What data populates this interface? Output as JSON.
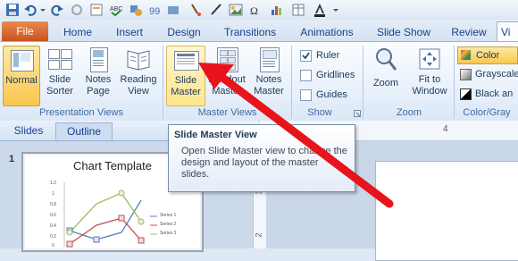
{
  "qat": {
    "icons": [
      "save-icon",
      "undo-icon",
      "redo-icon",
      "repeat-icon",
      "new-slide-icon",
      "spelling-icon",
      "shapes-icon",
      "format-painter-icon",
      "eyedropper-icon",
      "picture-icon",
      "symbol-icon",
      "chart-icon",
      "font-color-icon"
    ]
  },
  "tabs": {
    "file": "File",
    "items": [
      "Home",
      "Insert",
      "Design",
      "Transitions",
      "Animations",
      "Slide Show",
      "Review"
    ],
    "active": "Vi"
  },
  "ribbon": {
    "presentation_views": {
      "label": "Presentation Views",
      "normal": "Normal",
      "slide_sorter": [
        "Slide",
        "Sorter"
      ],
      "notes_page": [
        "Notes",
        "Page"
      ],
      "reading_view": [
        "Reading",
        "View"
      ]
    },
    "master_views": {
      "label": "Master Views",
      "slide_master": [
        "Slide",
        "Master"
      ],
      "handout_master": [
        "Handout",
        "Master"
      ],
      "notes_master": [
        "Notes",
        "Master"
      ]
    },
    "show": {
      "label": "Show",
      "ruler": "Ruler",
      "ruler_checked": true,
      "gridlines": "Gridlines",
      "gridlines_checked": false,
      "guides": "Guides",
      "guides_checked": false
    },
    "zoom": {
      "label": "Zoom",
      "zoom": "Zoom",
      "fit_to_window": [
        "Fit to",
        "Window"
      ]
    },
    "color_grayscale": {
      "label": "Color/Gray",
      "color": "Color",
      "grayscale": "Grayscale",
      "black_and_white": "Black an"
    }
  },
  "pane": {
    "slides_tab": "Slides",
    "outline_tab": "Outline",
    "slide_number": "1"
  },
  "thumbnail": {
    "title": "Chart Template",
    "y_ticks": [
      "1.2",
      "1",
      "0.8",
      "0.6",
      "0.4",
      "0.2",
      "0"
    ],
    "legend": [
      "Series 1",
      "Series 2",
      "Series 3"
    ]
  },
  "ruler": {
    "top_mark": "4",
    "side_marks": [
      "1",
      "2"
    ]
  },
  "tooltip": {
    "title": "Slide Master View",
    "body": "Open Slide Master view to change the design and layout of the master slides."
  },
  "colors": {
    "accent": "#f9c74c",
    "file_tab": "#c9531e",
    "arrow": "#e8141b"
  }
}
